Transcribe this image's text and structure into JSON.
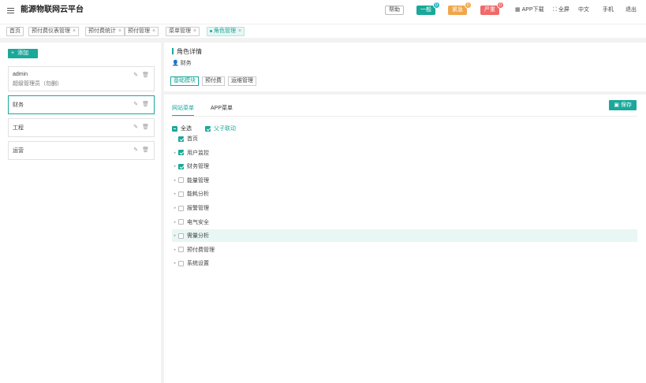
{
  "header": {
    "title": "能源物联网云平台",
    "help": "帮助",
    "alarms": [
      {
        "label": "一般",
        "count": "0"
      },
      {
        "label": "紧急",
        "count": "0"
      },
      {
        "label": "严重",
        "count": "0"
      }
    ],
    "app_download": "APP下载",
    "fullscreen": "全屏",
    "language": "中文",
    "user": "手机",
    "logout": "退出"
  },
  "tabs": [
    {
      "label": "首页"
    },
    {
      "label": "预付费仪表管理"
    },
    {
      "label": "预付费统计"
    },
    {
      "label": "预付管理"
    },
    {
      "label": "菜单管理"
    },
    {
      "label": "角色管理"
    }
  ],
  "left": {
    "add_label": "添加",
    "roles": [
      {
        "name": "admin",
        "desc": "超级管理员（勿删）"
      },
      {
        "name": "财务",
        "desc": ""
      },
      {
        "name": "工程",
        "desc": ""
      },
      {
        "name": "运营",
        "desc": ""
      }
    ]
  },
  "detail": {
    "title": "角色详情",
    "role_label": "财务",
    "subtabs": [
      "基础模块",
      "预付费",
      "运维管理"
    ]
  },
  "menu_tabs": [
    "网站菜单",
    "APP菜单"
  ],
  "save_label": "保存",
  "options": {
    "select_all": "全选",
    "linkage": "父子联动"
  },
  "tree": [
    {
      "label": "首页",
      "checked": true
    },
    {
      "label": "用户监控",
      "checked": true
    },
    {
      "label": "财务管理",
      "checked": true
    },
    {
      "label": "能量管理",
      "checked": false
    },
    {
      "label": "能耗分析",
      "checked": false
    },
    {
      "label": "报警管理",
      "checked": false
    },
    {
      "label": "电气安全",
      "checked": false
    },
    {
      "label": "需量分析",
      "checked": false
    },
    {
      "label": "预付费管理",
      "checked": false
    },
    {
      "label": "系统设置",
      "checked": false
    }
  ],
  "colors": {
    "accent": "#1aa89a",
    "warning": "#f0a64a",
    "danger": "#ef6a6a"
  }
}
